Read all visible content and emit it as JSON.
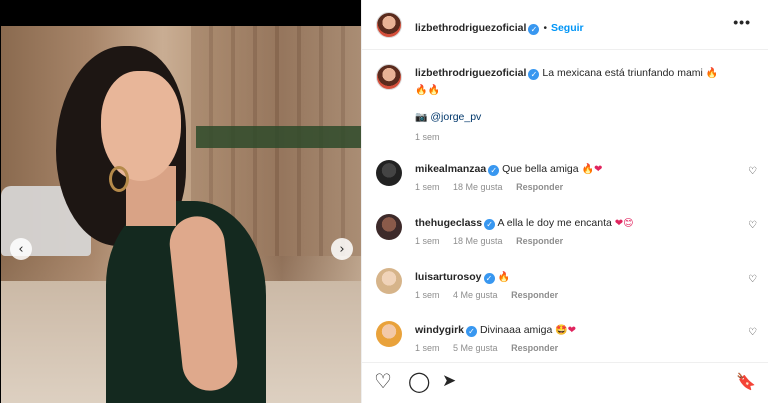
{
  "post": {
    "author": "lizbethrodriguezoficial",
    "follow_label": "Seguir",
    "more_label": "•••",
    "caption_text": "La mexicana está triunfando mami",
    "caption_emojis_1": "🔥",
    "caption_emojis_2": "🔥🔥",
    "camera_emoji": "📷",
    "photo_credit": "@jorge_pv",
    "time": "1 sem"
  },
  "carousel": {
    "prev_icon": "‹",
    "next_icon": "›"
  },
  "comments": [
    {
      "user": "mikealmanzaa",
      "text": "Que bella amiga",
      "emojis": "🔥❤",
      "time": "1 sem",
      "likes": "18 Me gusta",
      "reply": "Responder"
    },
    {
      "user": "thehugeclass",
      "text": "A ella le doy me encanta",
      "emojis": "❤😊",
      "time": "1 sem",
      "likes": "18 Me gusta",
      "reply": "Responder"
    },
    {
      "user": "luisarturosoy",
      "text": "",
      "emojis": "🔥",
      "time": "1 sem",
      "likes": "4 Me gusta",
      "reply": "Responder"
    },
    {
      "user": "windygirk",
      "text": "Divinaaa amiga",
      "emojis": "🤩❤",
      "time": "1 sem",
      "likes": "5 Me gusta",
      "reply": "Responder"
    }
  ],
  "icons": {
    "heart_small": "♡",
    "like": "♡",
    "comment": "◯",
    "share": "➤",
    "save": "🔖"
  },
  "colors": {
    "accent": "#0095f6",
    "verified": "#3897f0",
    "muted": "#8e8e8e"
  }
}
